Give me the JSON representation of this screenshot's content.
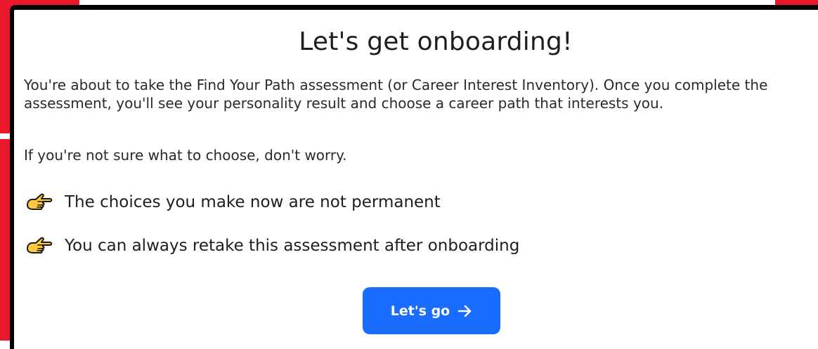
{
  "colors": {
    "accent": "#1a6cff",
    "backdrop": "#e8192c",
    "hand_fill": "#ffc83d"
  },
  "modal": {
    "title": "Let's get onboarding!",
    "intro": "You're about to take the Find Your Path assessment (or Career Interest Inventory). Once you complete the assessment, you'll see your personality result and choose a career path that interests you.",
    "reassurance": "If you're not sure what to choose, don't worry.",
    "bullets": [
      {
        "icon": "pointing-hand-icon",
        "text": "The choices you make now are not permanent"
      },
      {
        "icon": "pointing-hand-icon",
        "text": "You can always retake this assessment after onboarding"
      }
    ],
    "cta": {
      "label": "Let's go",
      "icon": "arrow-right-icon"
    }
  }
}
